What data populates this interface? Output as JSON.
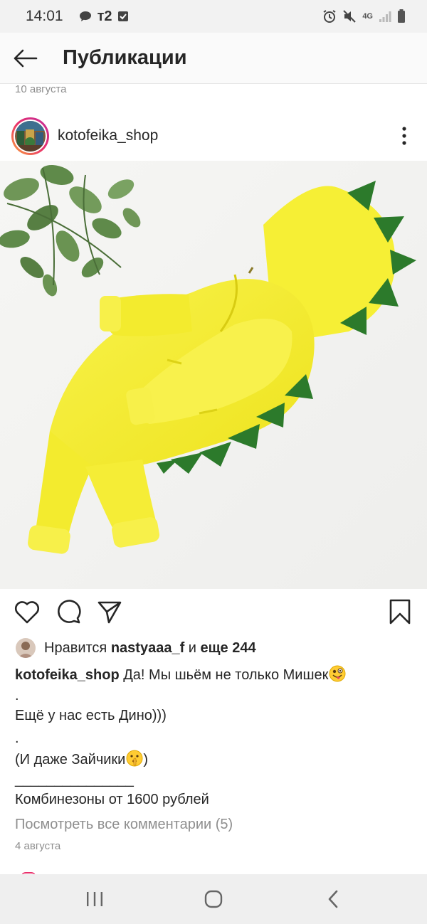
{
  "status_bar": {
    "time": "14:01",
    "carrier": "т2",
    "network": "4G"
  },
  "header": {
    "title": "Публикации"
  },
  "previous_post": {
    "date": "10 августа"
  },
  "post": {
    "username": "kotofeika_shop",
    "likes": {
      "prefix": "Нравится",
      "user": "nastyaaa_f",
      "joiner": "и",
      "others": "еще 244"
    },
    "caption": {
      "author": "kotofeika_shop",
      "line1": "Да! Мы шьём не только Мишек",
      "line2": ".",
      "line3": "Ещё у нас есть Дино)))",
      "line4": ".",
      "line5_a": "(И даже Зайчики",
      "line5_b": ")",
      "line6": "_______________",
      "line7": "Комбинезоны от 1600 рублей"
    },
    "view_comments": "Посмотреть все комментарии (5)",
    "date": "4 августа"
  },
  "icons": {
    "back": "arrow-left-icon",
    "more": "more-vertical-icon",
    "like": "heart-icon",
    "comment": "comment-icon",
    "share": "send-icon",
    "save": "bookmark-icon",
    "emoji1": "winking-tongue-emoji",
    "emoji2": "shushing-face-emoji"
  },
  "colors": {
    "suit_yellow": "#f5ef3a",
    "spikes_green": "#2c7a2b",
    "text_primary": "#262626",
    "text_secondary": "#8e8e8e",
    "story_ring": "#e9306b"
  }
}
